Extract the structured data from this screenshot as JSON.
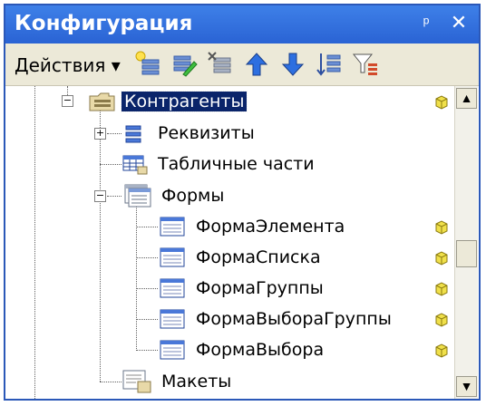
{
  "window": {
    "title": "Конфигурация",
    "pin_glyph": "ᵖ",
    "close_glyph": "✕"
  },
  "toolbar": {
    "actions_label": "Действия ▾",
    "icons": [
      "add-icon",
      "edit-icon",
      "delete-icon",
      "move-up-icon",
      "move-down-icon",
      "sort-icon",
      "filter-icon"
    ]
  },
  "tree": {
    "root": {
      "label": "Контрагенты",
      "icon": "catalog-icon"
    },
    "items": [
      {
        "label": "Реквизиты",
        "icon": "attributes-icon"
      },
      {
        "label": "Табличные части",
        "icon": "tabular-sections-icon"
      },
      {
        "label": "Формы",
        "icon": "forms-icon"
      },
      {
        "label": "ФормаЭлемента",
        "icon": "form-icon"
      },
      {
        "label": "ФормаСписка",
        "icon": "form-icon"
      },
      {
        "label": "ФормаГруппы",
        "icon": "form-icon"
      },
      {
        "label": "ФормаВыбораГруппы",
        "icon": "form-icon"
      },
      {
        "label": "ФормаВыбора",
        "icon": "form-icon"
      },
      {
        "label": "Макеты",
        "icon": "templates-icon"
      }
    ]
  },
  "scrollbar": {
    "up": "▲",
    "down": "▼"
  },
  "colors": {
    "title_bar": "#2a63d4",
    "selection": "#0a246a",
    "toolbar": "#ece9d8"
  }
}
